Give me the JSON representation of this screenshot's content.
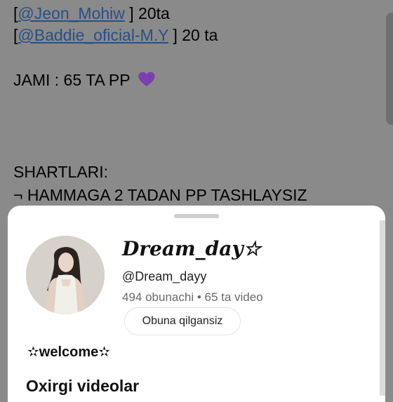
{
  "background": {
    "line1": {
      "open": "[",
      "mention": "@Jeon_Mohiw",
      "close": " ] 20ta"
    },
    "line2": {
      "open": " [",
      "mention": "@Baddie_oficial-M.Y",
      "close": " ] 20 ta"
    },
    "total_text": "JAMI : 65 TA PP",
    "total_icon": "purple-heart-icon",
    "rules_heading": "SHARTLARI:",
    "rules_item": "¬ HAMMAGA 2 TADAN PP TASHLAYSIZ"
  },
  "sheet": {
    "channel_name": "Dream_day☆",
    "handle": "@Dream_dayy",
    "stats": "494 obunachi • 65 ta video",
    "subscribe_label": "Obuna qilgansiz",
    "description": "✫welcome✫",
    "section_title": "Oxirgi videolar"
  },
  "colors": {
    "accent_link": "#2a4f86",
    "heart": "#7b3fb0",
    "overlay": "#8a8a8a"
  }
}
